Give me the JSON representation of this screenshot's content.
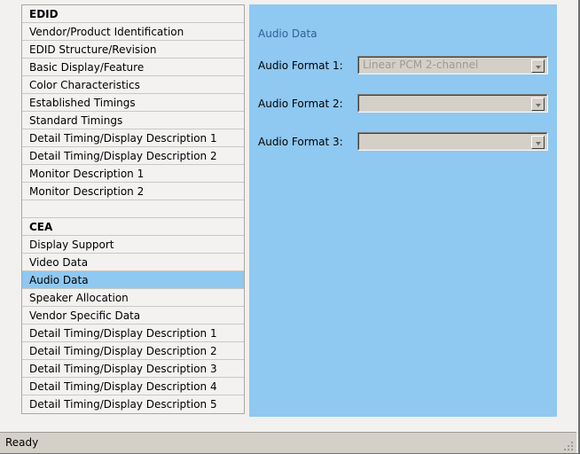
{
  "window": {
    "status_text": "Ready"
  },
  "nav": {
    "sections": [
      {
        "header": "EDID",
        "items": [
          "Vendor/Product Identification",
          "EDID Structure/Revision",
          "Basic Display/Feature",
          "Color Characteristics",
          "Established Timings",
          "Standard Timings",
          "Detail Timing/Display Description 1",
          "Detail Timing/Display Description 2",
          "Monitor Description 1",
          "Monitor Description 2"
        ]
      },
      {
        "header": "CEA",
        "items": [
          "Display Support",
          "Video Data",
          "Audio Data",
          "Speaker Allocation",
          "Vendor Specific Data",
          "Detail Timing/Display Description 1",
          "Detail Timing/Display Description 2",
          "Detail Timing/Display Description 3",
          "Detail Timing/Display Description 4",
          "Detail Timing/Display Description 5"
        ]
      }
    ],
    "selected": "Audio Data"
  },
  "panel": {
    "title": "Audio Data",
    "fields": [
      {
        "label": "Audio Format 1:",
        "value": "Linear PCM 2-channel",
        "disabled": true
      },
      {
        "label": "Audio Format 2:",
        "value": "",
        "disabled": false
      },
      {
        "label": "Audio Format 3:",
        "value": "",
        "disabled": false
      }
    ]
  },
  "colors": {
    "panel_background": "#8fc8f0",
    "selection": "#8fc8f0",
    "panel_title_text": "#2d6294",
    "window_background": "#f2f1ef",
    "list_background": "#f3f2f0",
    "status_background": "#d4d0c8",
    "combo_background": "#d4d0c8",
    "disabled_text": "#9a9a94"
  }
}
